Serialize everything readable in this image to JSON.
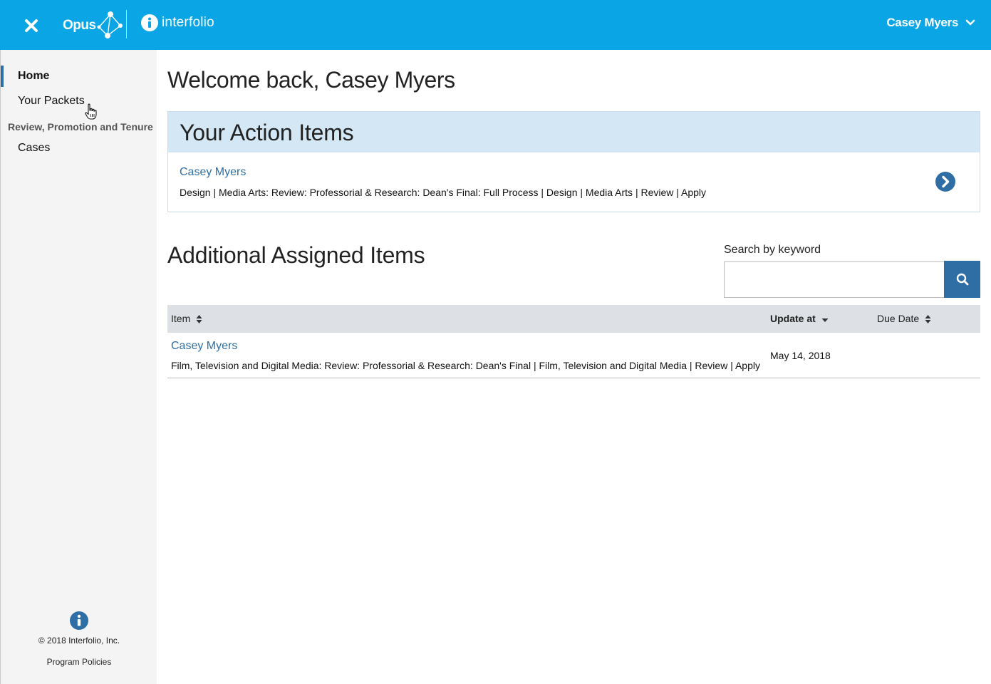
{
  "header": {
    "close_icon": "close-x-icon",
    "brand_opus": "Opus",
    "brand_interfolio": "interfolio",
    "user_name": "Casey Myers",
    "accent_color": "#0aa5e4"
  },
  "sidebar": {
    "items": [
      {
        "label": "Home",
        "active": true
      },
      {
        "label": "Your Packets",
        "active": false
      }
    ],
    "section_label": "Review, Promotion and Tenure",
    "section_items": [
      {
        "label": "Cases"
      }
    ],
    "footer": {
      "copyright": "© 2018 Interfolio, Inc.",
      "policies_link": "Program Policies"
    }
  },
  "main": {
    "welcome": "Welcome back, Casey Myers",
    "action_items": {
      "title": "Your Action Items",
      "entries": [
        {
          "name": "Casey Myers",
          "description": "Design | Media Arts: Review: Professorial & Research: Dean's Final: Full Process | Design | Media Arts | Review | Apply"
        }
      ]
    },
    "additional": {
      "title": "Additional Assigned Items",
      "search_label": "Search by keyword",
      "search_value": "",
      "columns": [
        "Item",
        "Update at",
        "Due Date"
      ],
      "rows": [
        {
          "name": "Casey Myers",
          "description": "Film, Television and Digital Media: Review: Professorial & Research: Dean's Final | Film, Television and Digital Media | Review | Apply",
          "update_at": "May 14, 2018",
          "due_date": ""
        }
      ]
    }
  },
  "colors": {
    "link": "#2f6ea5",
    "panel_head": "#d3e7f4",
    "table_head": "#dde0e4",
    "sidebar_bg": "#f4f4f4"
  }
}
